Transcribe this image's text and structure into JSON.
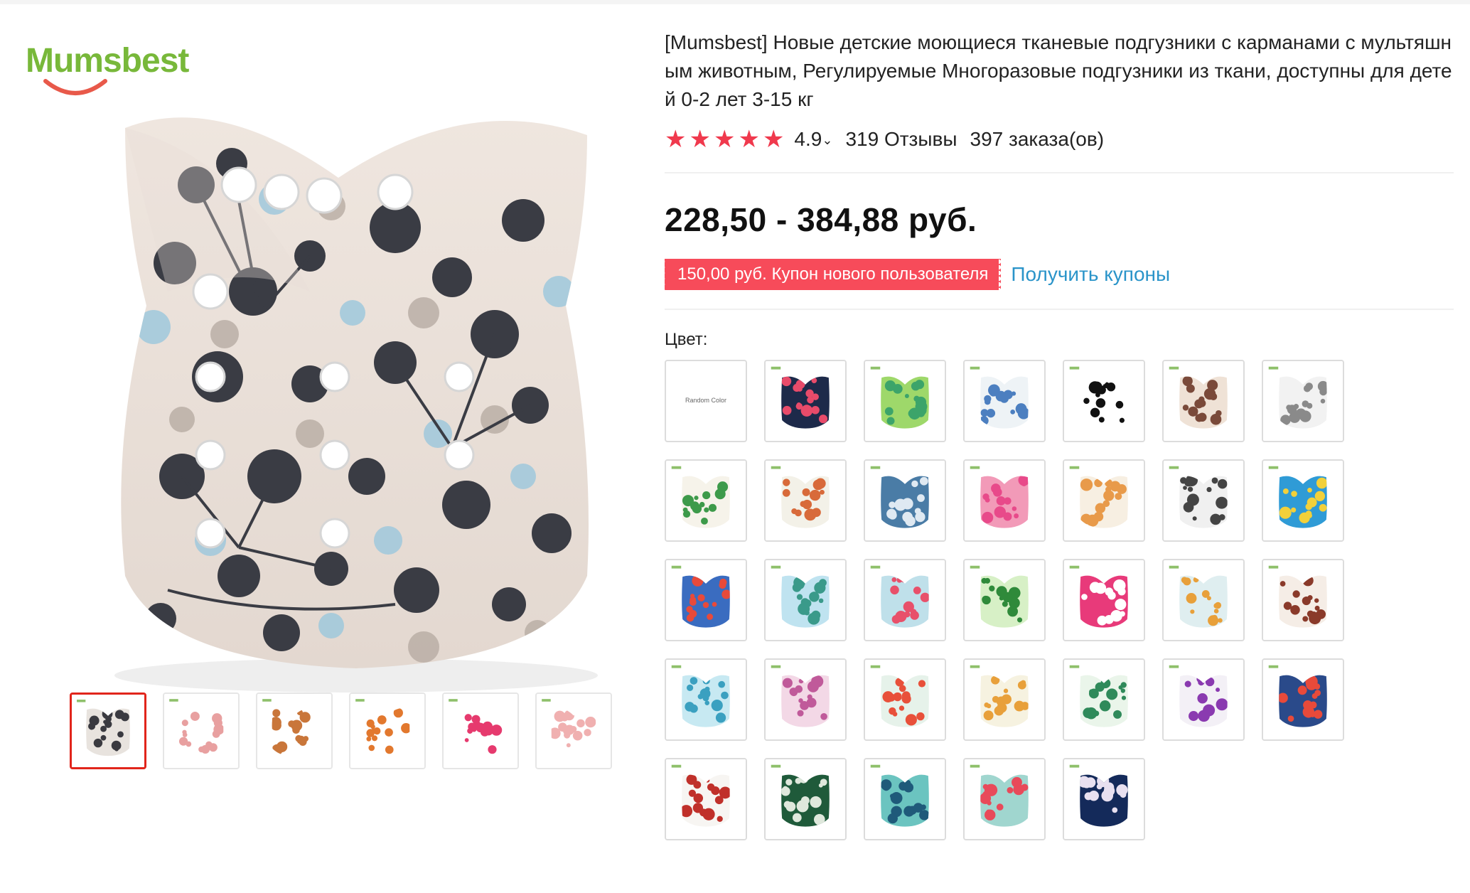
{
  "logo": {
    "text": "Mumsbest",
    "color": "#78b83a"
  },
  "product": {
    "title": "[Mumsbest] Новые детские моющиеся тканевые подгузники с карманами с мультяшным животным, Регулируемые Многоразовые подгузники из ткани, доступны для детей 0-2 лет 3-15 кг",
    "rating": "4.9",
    "reviews": "319 Отзывы",
    "orders": "397 заказа(ов)",
    "price": "228,50 - 384,88 руб.",
    "coupon": "150,00 руб. Купон нового пользователя",
    "coupon_link": "Получить купоны",
    "color_label": "Цвет:",
    "star_color": "#f0394d",
    "accent_link_color": "#2a94c9",
    "coupon_color": "#f74b5a"
  },
  "thumbnails": [
    {
      "name": "thumb-main",
      "active": true,
      "bg": "#e8e3de",
      "print": "#3a3a40"
    },
    {
      "name": "thumb-info",
      "active": false,
      "bg": "#ffffff",
      "print": "#e8a0a0"
    },
    {
      "name": "thumb-sizes",
      "active": false,
      "bg": "#ffffff",
      "print": "#c9763a"
    },
    {
      "name": "thumb-howto",
      "active": false,
      "bg": "#ffffff",
      "print": "#e2782e"
    },
    {
      "name": "thumb-open",
      "active": false,
      "bg": "#ffffff",
      "print": "#e63a6e"
    },
    {
      "name": "thumb-inserts",
      "active": false,
      "bg": "#ffffff",
      "print": "#f0b0b0"
    }
  ],
  "swatches": [
    {
      "random": true,
      "text": "Random Color"
    },
    {
      "bg": "#1d2a4a",
      "print": "#e84b6a"
    },
    {
      "bg": "#9ed86a",
      "print": "#3ca46a"
    },
    {
      "bg": "#eef3f6",
      "print": "#4c7fc0"
    },
    {
      "bg": "#ffffff",
      "print": "#111111"
    },
    {
      "bg": "#efe2d6",
      "print": "#7a4a3a"
    },
    {
      "bg": "#f2f2f2",
      "print": "#8a8a8a"
    },
    {
      "bg": "#f6f3ea",
      "print": "#3d9a4a"
    },
    {
      "bg": "#f3f1e8",
      "print": "#d86a3a"
    },
    {
      "bg": "#4a7ca6",
      "print": "#dfe9f2"
    },
    {
      "bg": "#f29ab8",
      "print": "#e84a8a"
    },
    {
      "bg": "#f7efe2",
      "print": "#e89a4a"
    },
    {
      "bg": "#f0f0f0",
      "print": "#444444"
    },
    {
      "bg": "#2f9bd6",
      "print": "#f2d03a"
    },
    {
      "bg": "#3a6cc0",
      "print": "#e84a3a"
    },
    {
      "bg": "#bfe3f0",
      "print": "#3a9a8a"
    },
    {
      "bg": "#bfe0ea",
      "print": "#e8506a"
    },
    {
      "bg": "#d7f0c6",
      "print": "#2f8a3a"
    },
    {
      "bg": "#e83a7a",
      "print": "#ffffff"
    },
    {
      "bg": "#dfeef0",
      "print": "#e8a03a"
    },
    {
      "bg": "#f5ede6",
      "print": "#8a3a2a"
    },
    {
      "bg": "#c7e9f2",
      "print": "#3aa0c0"
    },
    {
      "bg": "#f3d8e6",
      "print": "#c05a9a"
    },
    {
      "bg": "#e6f2ea",
      "print": "#e8503a"
    },
    {
      "bg": "#f6f2e0",
      "print": "#e8a03a"
    },
    {
      "bg": "#eaf5ea",
      "print": "#2f8a5a"
    },
    {
      "bg": "#f3f0f6",
      "print": "#8a3ab0"
    },
    {
      "bg": "#2a4a8a",
      "print": "#e84a3a"
    },
    {
      "bg": "#f7f5f2",
      "print": "#c0302a"
    },
    {
      "bg": "#1f5a3a",
      "print": "#dfe8dc"
    },
    {
      "bg": "#6bc4c0",
      "print": "#1f5a7a"
    },
    {
      "bg": "#a0d6cf",
      "print": "#e84a5a"
    },
    {
      "bg": "#142a5a",
      "print": "#e8e0f0"
    }
  ]
}
